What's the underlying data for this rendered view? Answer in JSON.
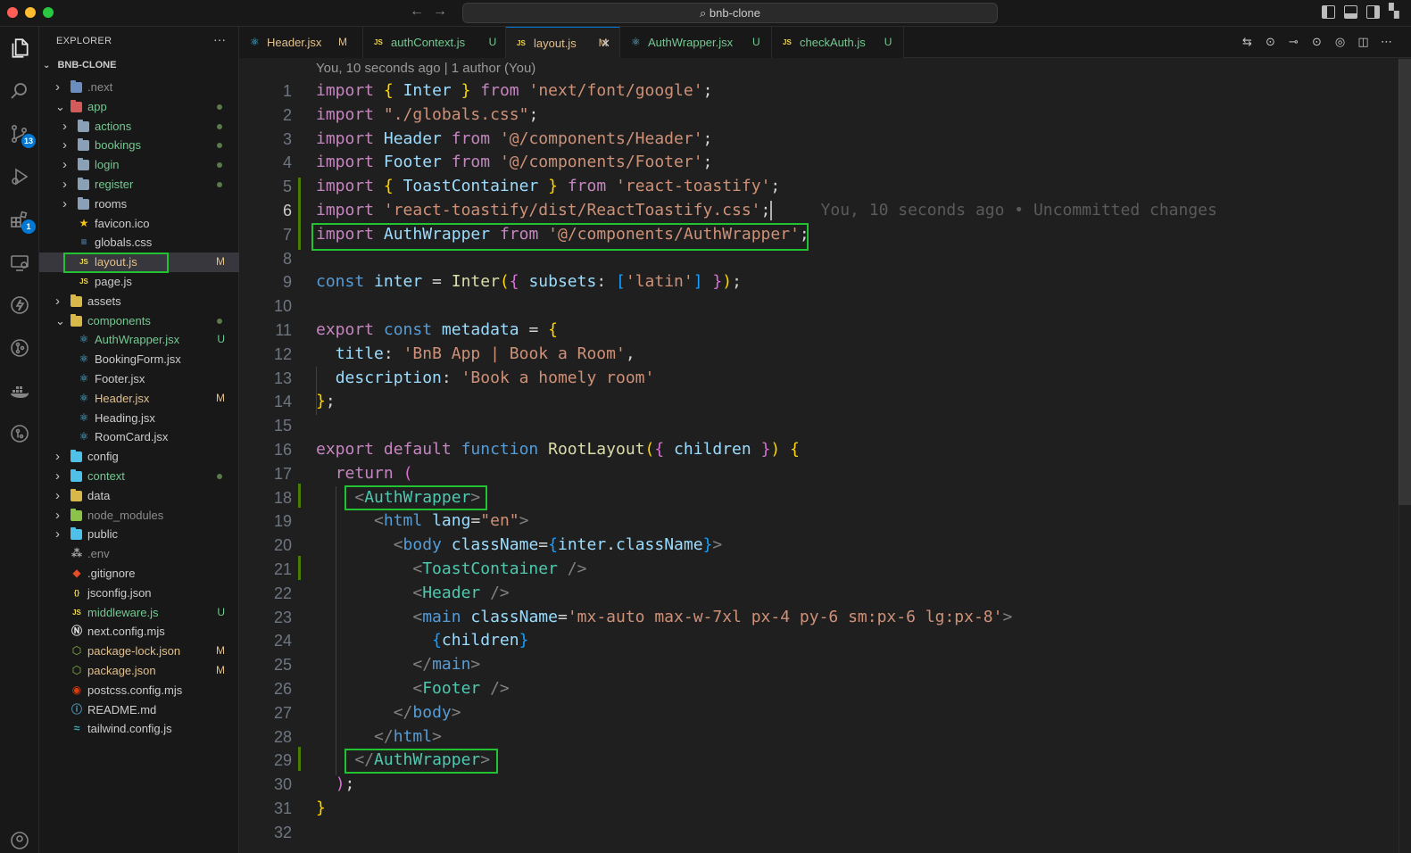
{
  "window": {
    "search_text": "bnb-clone"
  },
  "activity_bar": {
    "scm_badge": "13",
    "extensions_badge": "1"
  },
  "explorer": {
    "title": "EXPLORER",
    "more": "···",
    "root": "BNB-CLONE",
    "items": [
      {
        "name": ".next",
        "depth": 0,
        "type": "folder",
        "open": false,
        "color": "#8c8c8c",
        "status": ""
      },
      {
        "name": "app",
        "depth": 0,
        "type": "folder",
        "open": true,
        "color": "#73c991",
        "status": "dot"
      },
      {
        "name": "actions",
        "depth": 1,
        "type": "folder",
        "open": false,
        "color": "#73c991",
        "status": "dot"
      },
      {
        "name": "bookings",
        "depth": 1,
        "type": "folder",
        "open": false,
        "color": "#73c991",
        "status": "dot"
      },
      {
        "name": "login",
        "depth": 1,
        "type": "folder",
        "open": false,
        "color": "#73c991",
        "status": "dot"
      },
      {
        "name": "register",
        "depth": 1,
        "type": "folder",
        "open": false,
        "color": "#73c991",
        "status": "dot"
      },
      {
        "name": "rooms",
        "depth": 1,
        "type": "folder",
        "open": false,
        "color": "#cccccc",
        "status": ""
      },
      {
        "name": "favicon.ico",
        "depth": 1,
        "type": "star",
        "color": "#cccccc",
        "status": ""
      },
      {
        "name": "globals.css",
        "depth": 1,
        "type": "css",
        "color": "#cccccc",
        "status": ""
      },
      {
        "name": "layout.js",
        "depth": 1,
        "type": "js",
        "color": "#e2c08d",
        "status": "M",
        "selected": true
      },
      {
        "name": "page.js",
        "depth": 1,
        "type": "js",
        "color": "#cccccc",
        "status": ""
      },
      {
        "name": "assets",
        "depth": 0,
        "type": "folder",
        "open": false,
        "color": "#cccccc",
        "status": ""
      },
      {
        "name": "components",
        "depth": 0,
        "type": "folder",
        "open": true,
        "color": "#73c991",
        "status": "dot"
      },
      {
        "name": "AuthWrapper.jsx",
        "depth": 1,
        "type": "react",
        "color": "#73c991",
        "status": "U"
      },
      {
        "name": "BookingForm.jsx",
        "depth": 1,
        "type": "react",
        "color": "#cccccc",
        "status": ""
      },
      {
        "name": "Footer.jsx",
        "depth": 1,
        "type": "react",
        "color": "#cccccc",
        "status": ""
      },
      {
        "name": "Header.jsx",
        "depth": 1,
        "type": "react",
        "color": "#e2c08d",
        "status": "M"
      },
      {
        "name": "Heading.jsx",
        "depth": 1,
        "type": "react",
        "color": "#cccccc",
        "status": ""
      },
      {
        "name": "RoomCard.jsx",
        "depth": 1,
        "type": "react",
        "color": "#cccccc",
        "status": ""
      },
      {
        "name": "config",
        "depth": 0,
        "type": "folder",
        "open": false,
        "color": "#cccccc",
        "status": ""
      },
      {
        "name": "context",
        "depth": 0,
        "type": "folder",
        "open": false,
        "color": "#73c991",
        "status": "dot"
      },
      {
        "name": "data",
        "depth": 0,
        "type": "folder",
        "open": false,
        "color": "#cccccc",
        "status": ""
      },
      {
        "name": "node_modules",
        "depth": 0,
        "type": "folder",
        "open": false,
        "color": "#8c8c8c",
        "status": ""
      },
      {
        "name": "public",
        "depth": 0,
        "type": "folder",
        "open": false,
        "color": "#cccccc",
        "status": ""
      },
      {
        "name": ".env",
        "depth": 0,
        "type": "env",
        "color": "#8c8c8c",
        "status": ""
      },
      {
        "name": ".gitignore",
        "depth": 0,
        "type": "git",
        "color": "#cccccc",
        "status": ""
      },
      {
        "name": "jsconfig.json",
        "depth": 0,
        "type": "json",
        "color": "#cccccc",
        "status": ""
      },
      {
        "name": "middleware.js",
        "depth": 0,
        "type": "js",
        "color": "#73c991",
        "status": "U"
      },
      {
        "name": "next.config.mjs",
        "depth": 0,
        "type": "next",
        "color": "#cccccc",
        "status": ""
      },
      {
        "name": "package-lock.json",
        "depth": 0,
        "type": "npm",
        "color": "#e2c08d",
        "status": "M"
      },
      {
        "name": "package.json",
        "depth": 0,
        "type": "npm",
        "color": "#e2c08d",
        "status": "M"
      },
      {
        "name": "postcss.config.mjs",
        "depth": 0,
        "type": "postcss",
        "color": "#cccccc",
        "status": ""
      },
      {
        "name": "README.md",
        "depth": 0,
        "type": "info",
        "color": "#cccccc",
        "status": ""
      },
      {
        "name": "tailwind.config.js",
        "depth": 0,
        "type": "tailwind",
        "color": "#cccccc",
        "status": ""
      }
    ]
  },
  "tabs": [
    {
      "label": "Header.jsx",
      "status": "M",
      "type": "react",
      "color": "#e2c08d",
      "active": false
    },
    {
      "label": "authContext.js",
      "status": "U",
      "type": "js",
      "color": "#73c991",
      "active": false
    },
    {
      "label": "layout.js",
      "status": "M",
      "type": "js",
      "color": "#e2c08d",
      "active": true,
      "close": "✕"
    },
    {
      "label": "AuthWrapper.jsx",
      "status": "U",
      "type": "react",
      "color": "#73c991",
      "active": false
    },
    {
      "label": "checkAuth.js",
      "status": "U",
      "type": "js",
      "color": "#73c991",
      "active": false
    }
  ],
  "editor": {
    "blame_header": "You, 10 seconds ago | 1 author (You)",
    "inline_blame": "You, 10 seconds ago • Uncommitted changes",
    "current_line": 6,
    "line_numbers": [
      "1",
      "2",
      "3",
      "4",
      "5",
      "6",
      "7",
      "8",
      "9",
      "10",
      "11",
      "12",
      "13",
      "14",
      "15",
      "16",
      "17",
      "18",
      "19",
      "20",
      "21",
      "22",
      "23",
      "24",
      "25",
      "26",
      "27",
      "28",
      "29",
      "30",
      "31",
      "32"
    ]
  },
  "icons": {
    "explorer": "files-icon",
    "search": "search-icon",
    "scm": "source-control-icon",
    "debug": "run-debug-icon",
    "extensions": "extensions-icon",
    "remote": "remote-explorer-icon",
    "thunder": "thunder-client-icon",
    "gitlens": "gitlens-icon",
    "docker": "docker-icon",
    "gitgraph": "git-graph-icon",
    "account": "account-icon"
  }
}
